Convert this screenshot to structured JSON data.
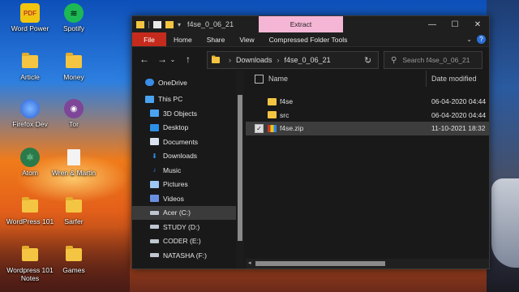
{
  "desktop": {
    "icons": [
      {
        "label": "Word Power",
        "icon": "word-power-icon"
      },
      {
        "label": "Spotify",
        "icon": "spotify-icon"
      },
      {
        "label": "Article",
        "icon": "folder-icon"
      },
      {
        "label": "Money",
        "icon": "folder-icon"
      },
      {
        "label": "Firefox Dev",
        "icon": "firefox-icon"
      },
      {
        "label": "Tor",
        "icon": "tor-icon"
      },
      {
        "label": "Atom",
        "icon": "atom-icon"
      },
      {
        "label": "Wren & Martin",
        "icon": "document-icon"
      },
      {
        "label": "WordPress 101",
        "icon": "folder-icon"
      },
      {
        "label": "Sarfer",
        "icon": "folder-icon"
      },
      {
        "label": "Wordpress 101 Notes",
        "icon": "folder-icon"
      },
      {
        "label": "Games",
        "icon": "folder-icon"
      }
    ]
  },
  "window": {
    "title": "f4se_0_06_21",
    "context_tab": "Extract",
    "controls": {
      "minimize": "—",
      "maximize": "☐",
      "close": "✕"
    }
  },
  "ribbon": {
    "tabs": [
      "File",
      "Home",
      "Share",
      "View",
      "Compressed Folder Tools"
    ]
  },
  "address": {
    "crumbs": [
      "Downloads",
      "f4se_0_06_21"
    ],
    "search_placeholder": "Search f4se_0_06_21"
  },
  "navpane": {
    "items": [
      {
        "label": "OneDrive",
        "icon": "cloud-icon",
        "color": "#3b8ee8"
      },
      {
        "label": "This PC",
        "icon": "computer-icon",
        "color": "#4aa3f0"
      },
      {
        "label": "3D Objects",
        "icon": "cube-icon",
        "color": "#4aa3f0"
      },
      {
        "label": "Desktop",
        "icon": "desktop-icon",
        "color": "#2d8fe6"
      },
      {
        "label": "Documents",
        "icon": "documents-icon",
        "color": "#d9e2ee"
      },
      {
        "label": "Downloads",
        "icon": "downloads-icon",
        "color": "#2d8fe6"
      },
      {
        "label": "Music",
        "icon": "music-icon",
        "color": "#3a7fe0"
      },
      {
        "label": "Pictures",
        "icon": "pictures-icon",
        "color": "#9ec7f2"
      },
      {
        "label": "Videos",
        "icon": "videos-icon",
        "color": "#6b8fe0"
      },
      {
        "label": "Acer (C:)",
        "icon": "drive-icon",
        "color": "#bfc6d0",
        "selected": true
      },
      {
        "label": "STUDY (D:)",
        "icon": "drive-icon",
        "color": "#bfc6d0"
      },
      {
        "label": "CODER (E:)",
        "icon": "drive-icon",
        "color": "#bfc6d0"
      },
      {
        "label": "NATASHA (F:)",
        "icon": "drive-icon",
        "color": "#bfc6d0"
      }
    ]
  },
  "files": {
    "headers": {
      "name": "Name",
      "date": "Date modified"
    },
    "rows": [
      {
        "name": "f4se",
        "date": "06-04-2020 04:44",
        "icon": "folder-icon"
      },
      {
        "name": "src",
        "date": "06-04-2020 04:44",
        "icon": "folder-icon"
      },
      {
        "name": "f4se.zip",
        "date": "11-10-2021 18:32",
        "icon": "zip-icon",
        "selected": true
      }
    ]
  },
  "colors": {
    "file_tab": "#c42b1c",
    "extract_tab": "#f5b6d6",
    "folder": "#f4c542"
  }
}
